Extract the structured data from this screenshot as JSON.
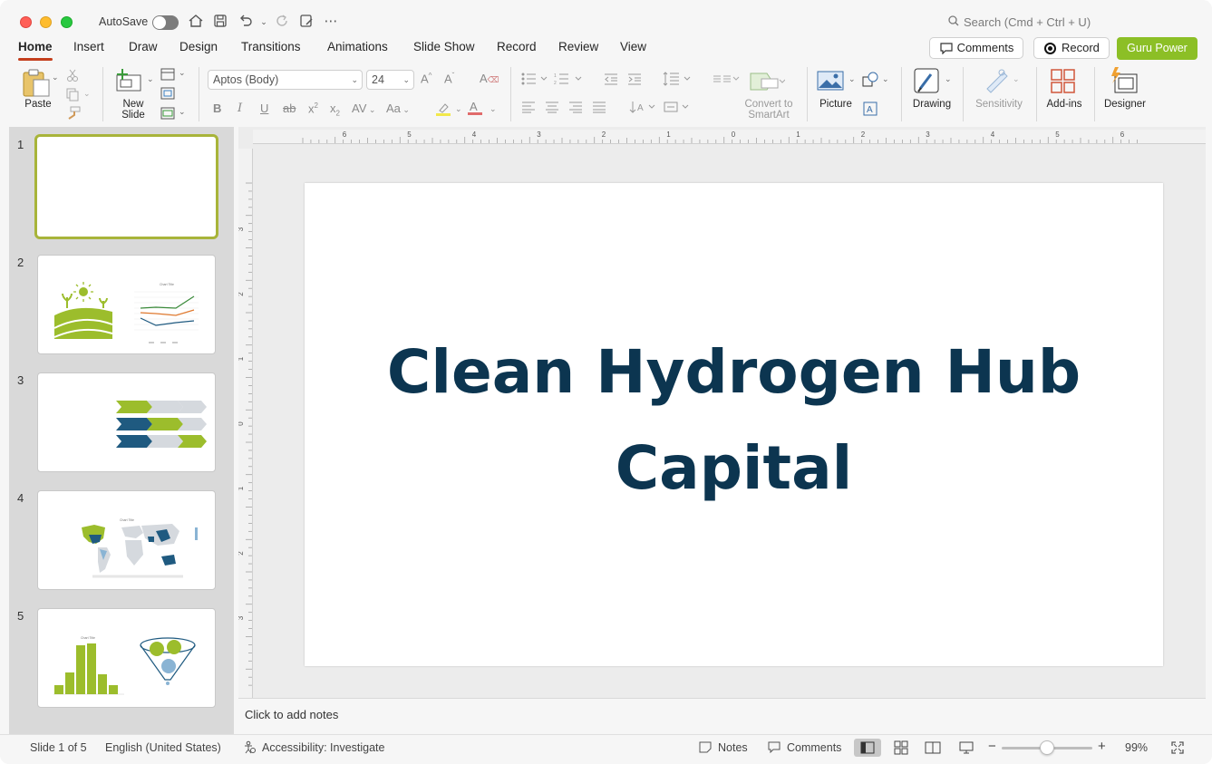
{
  "titlebar": {
    "autosave_label": "AutoSave",
    "search_placeholder": "Search (Cmd + Ctrl + U)"
  },
  "ribbon_tabs": [
    "Home",
    "Insert",
    "Draw",
    "Design",
    "Transitions",
    "Animations",
    "Slide Show",
    "Record",
    "Review",
    "View"
  ],
  "active_tab": "Home",
  "header_buttons": {
    "comments": "Comments",
    "record": "Record",
    "guru": "Guru Power"
  },
  "ribbon": {
    "paste": "Paste",
    "new_slide": "New\nSlide",
    "font_name": "Aptos (Body)",
    "font_size": "24",
    "convert_smartart": "Convert to\nSmartArt",
    "picture": "Picture",
    "drawing": "Drawing",
    "sensitivity": "Sensitivity",
    "add_ins": "Add-ins",
    "designer": "Designer"
  },
  "thumbnails": [
    {
      "num": "1"
    },
    {
      "num": "2",
      "chart_title": "Chart Title"
    },
    {
      "num": "3"
    },
    {
      "num": "4",
      "chart_title": "Chart Title"
    },
    {
      "num": "5",
      "chart_title": "Chart Title"
    }
  ],
  "slide": {
    "title_line1": "Clean Hydrogen Hub",
    "title_line2": "Capital"
  },
  "ruler": {
    "h_labels": [
      "6",
      "5",
      "4",
      "3",
      "2",
      "1",
      "0",
      "1",
      "2",
      "3",
      "4",
      "5",
      "6"
    ],
    "v_labels": [
      "3",
      "2",
      "1",
      "0",
      "1",
      "2",
      "3"
    ]
  },
  "notes_placeholder": "Click to add notes",
  "status": {
    "slide_info": "Slide 1 of 5",
    "language": "English (United States)",
    "accessibility": "Accessibility: Investigate",
    "notes": "Notes",
    "comments": "Comments",
    "zoom": "99%"
  },
  "colors": {
    "accent_green": "#8cbf26",
    "title_navy": "#0c3550",
    "tab_underline": "#c43e1c"
  }
}
